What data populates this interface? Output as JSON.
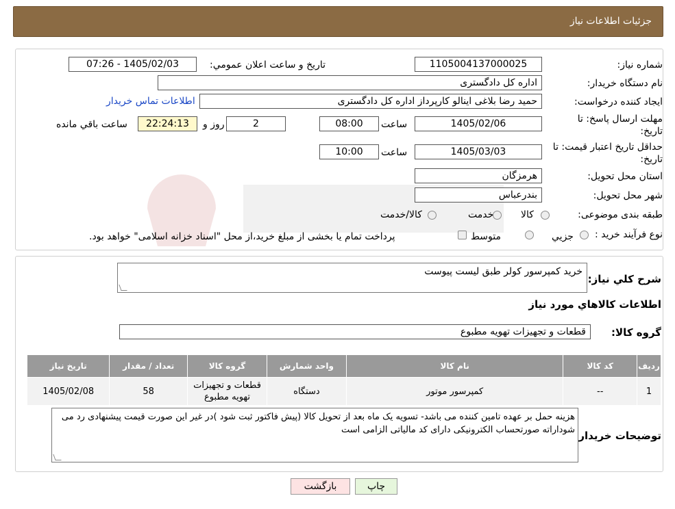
{
  "header": {
    "title": "جزئیات اطلاعات نیاز"
  },
  "form": {
    "need_number_label": "شماره نیاز:",
    "need_number": "1105004137000025",
    "announce_label": "تاریخ و ساعت اعلان عمومي:",
    "announce_value": "1405/02/03 - 07:26",
    "buyer_org_label": "نام دستگاه خریدار:",
    "buyer_org": "اداره کل دادگستری",
    "requester_label": "ایجاد کننده درخواست:",
    "requester": "حمید رضا  بلاغی اینالو کارپرداز اداره کل دادگستری",
    "contact_link": "اطلاعات تماس خریدار",
    "deadline_label_1": "مهلت ارسال پاسخ: تا",
    "deadline_label_2": "تاریخ:",
    "deadline_date": "1405/02/06",
    "time_label": "ساعت",
    "deadline_time": "08:00",
    "days_value": "2",
    "days_label": "روز و",
    "remaining_time": "22:24:13",
    "remaining_label": "ساعت باقي مانده",
    "validity_label_1": "حداقل تاریخ اعتبار قیمت: تا",
    "validity_label_2": "تاریخ:",
    "validity_date": "1405/03/03",
    "validity_time_label": "ساعت",
    "validity_time": "10:00",
    "province_label": "استان محل تحویل:",
    "province": "هرمزگان",
    "city_label": "شهر محل تحویل:",
    "city": "بندرعباس",
    "category_label": "طبقه بندی موضوعی:",
    "category_options": [
      "کالا",
      "خدمت",
      "کالا/خدمت"
    ],
    "process_label": "نوع فرآیند خرید :",
    "process_options": [
      "جزيي",
      "متوسط"
    ],
    "process_note": "پرداخت تمام یا بخشی از مبلغ خرید،از محل \"اسناد خزانه اسلامی\" خواهد بود."
  },
  "details": {
    "summary_label": "شرح كلي نياز:",
    "summary": "خرید کمپرسور کولر طبق لیست پیوست",
    "goods_info_title": "اطلاعات کالاهاي مورد نياز",
    "goods_group_label": "گروه کالا:",
    "goods_group": "قطعات و تجهیزات تهویه مطبوع",
    "table": {
      "headers": [
        "رديف",
        "کد کالا",
        "نام کالا",
        "واحد شمارش",
        "گروه کالا",
        "تعداد / مقدار",
        "تاریخ نیاز"
      ],
      "rows": [
        [
          "1",
          "--",
          "کمپرسور موتور",
          "دستگاه",
          "قطعات و تجهیزات تهویه مطبوع",
          "58",
          "1405/02/08"
        ]
      ]
    },
    "buyer_notes_label": "توضیحات خریدار:",
    "buyer_notes": "هزینه حمل بر عهده تامین کننده می باشد- تسویه یک ماه بعد از تحویل کالا (پیش فاکتور ثبت شود )در غیر این صورت قیمت پیشنهادی رد می شوداراته صورتحساب الکترونیکی دارای کد مالیاتی الزامی است"
  },
  "buttons": {
    "print": "چاپ",
    "back": "بازگشت"
  },
  "colors": {
    "header_bg": "#8b6b44",
    "link": "#1a47c6",
    "yellow_field": "#fff9cc",
    "back_button": "#fde3e3",
    "print_button": "#e6f6dc"
  }
}
